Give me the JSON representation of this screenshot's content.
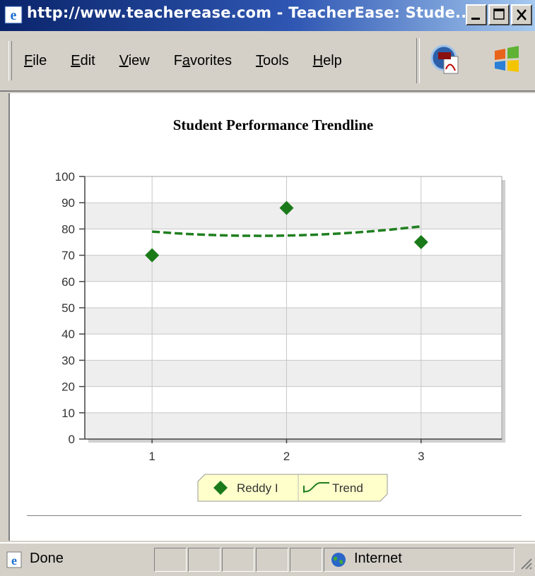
{
  "window": {
    "title": "http://www.teacherease.com - TeacherEase: Stude..."
  },
  "menu": {
    "items": [
      {
        "label": "File",
        "accel": "F"
      },
      {
        "label": "Edit",
        "accel": "E"
      },
      {
        "label": "View",
        "accel": "V"
      },
      {
        "label": "Favorites",
        "accel": "a"
      },
      {
        "label": "Tools",
        "accel": "T"
      },
      {
        "label": "Help",
        "accel": "H"
      }
    ]
  },
  "toolbar": {
    "icons": [
      "pdf-icon",
      "windows-logo-icon"
    ]
  },
  "colors": {
    "titlebar_start": "#0a246a",
    "series_green": "#1a7a1a",
    "trend_green": "#1f7f1f",
    "plot_band": "#eeeeee",
    "legend_bg": "#ffffcc"
  },
  "chart_data": {
    "type": "scatter",
    "title": "Student Performance Trendline",
    "categories": [
      "1",
      "2",
      "3"
    ],
    "x": [
      1,
      2,
      3
    ],
    "ylim": [
      0,
      100
    ],
    "yticks": [
      0,
      10,
      20,
      30,
      40,
      50,
      60,
      70,
      80,
      90,
      100
    ],
    "xlim": [
      0.5,
      3.6
    ],
    "grid": true,
    "legend_position": "bottom-center",
    "series": [
      {
        "name": "Reddy I",
        "type": "scatter",
        "marker": "diamond",
        "values": [
          70,
          88,
          75
        ]
      },
      {
        "name": "Trend",
        "type": "line",
        "style": "dashed",
        "values": [
          79,
          77.5,
          81
        ]
      }
    ]
  },
  "status": {
    "left_text": "Done",
    "zone_text": "Internet"
  }
}
